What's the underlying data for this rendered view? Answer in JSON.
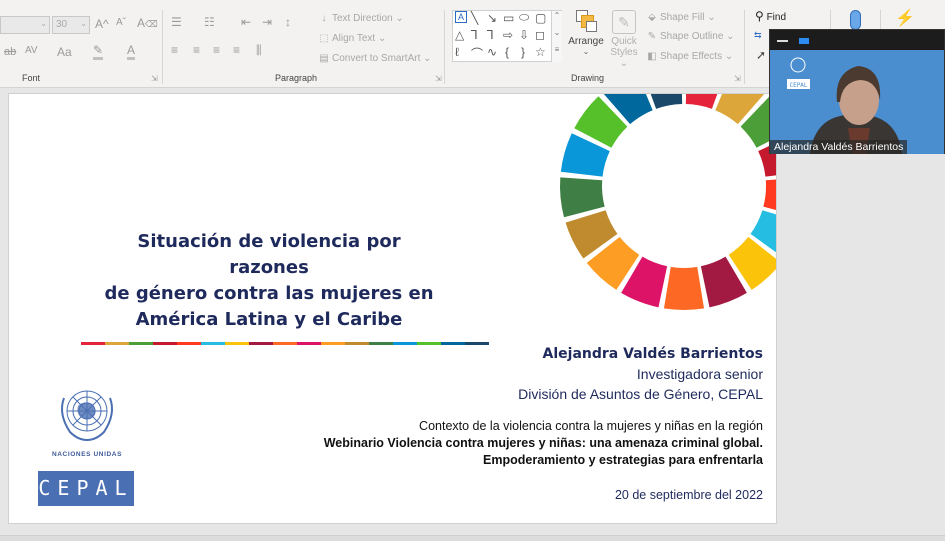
{
  "ribbon": {
    "font": {
      "label": "Font",
      "font_name_value": "",
      "font_size_value": "30",
      "grow_label": "A^",
      "shrink_label": "Aˇ",
      "clear_format_icon": "clear-formatting-icon",
      "strikethrough_label": "ab",
      "spacing_label": "AV",
      "case_label": "Aa",
      "highlight_label": "✎",
      "font_color_label": "A"
    },
    "paragraph": {
      "label": "Paragraph",
      "text_direction": "Text Direction",
      "align_text": "Align Text",
      "convert_smartart": "Convert to SmartArt"
    },
    "drawing": {
      "label": "Drawing",
      "arrange": "Arrange",
      "quick_styles_1": "Quick",
      "quick_styles_2": "Styles",
      "shape_fill": "Shape Fill",
      "shape_outline": "Shape Outline",
      "shape_effects": "Shape Effects"
    },
    "editing": {
      "find": "Find"
    }
  },
  "video": {
    "participant_name": "Alejandra Valdés Barrientos"
  },
  "slide": {
    "title_lines": [
      "Situación de violencia por razones",
      "de género contra las mujeres en",
      "América Latina y el Caribe"
    ],
    "author_name": "Alejandra Valdés Barrientos",
    "author_role": "Investigadora senior",
    "author_division": "División de Asuntos de Género, CEPAL",
    "context_line": "Contexto de la violencia contra la mujeres y niñas en la región",
    "webinar_line1": "Webinario Violencia contra mujeres y niñas: una amenaza criminal global.",
    "webinar_line2": "Empoderamiento y estrategias para enfrentarla",
    "date": "20 de septiembre del 2022",
    "un_label": "Naciones Unidas",
    "cepal_label": "CEPAL",
    "sdg_colors": [
      "#e5243b",
      "#dda63a",
      "#4c9f38",
      "#c5192d",
      "#ff3a21",
      "#26bde2",
      "#fcc30b",
      "#a21942",
      "#fd6925",
      "#dd1367",
      "#fd9d24",
      "#bf8b2e",
      "#3f7e44",
      "#0a97d9",
      "#56c02b",
      "#00689d",
      "#19486a"
    ]
  }
}
